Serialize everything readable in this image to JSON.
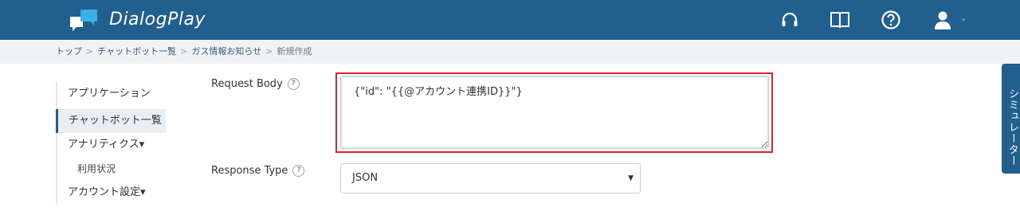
{
  "header": {
    "brand": "DialogPlay",
    "icons": [
      "headset-icon",
      "book-icon",
      "help-icon",
      "user-icon"
    ],
    "user_menu_caret": "⌄"
  },
  "breadcrumb": {
    "items": [
      "トップ",
      "チャットボット一覧",
      "ガス情報お知らせ"
    ],
    "current": "新規作成",
    "separator": ">"
  },
  "sidebar": {
    "items": [
      {
        "label": "アプリケーション"
      },
      {
        "label": "チャットボット一覧"
      },
      {
        "label": "アナリティクス▾"
      },
      {
        "label": "利用状況"
      },
      {
        "label": "アカウント設定▾"
      }
    ]
  },
  "form": {
    "request_body_label": "Request Body",
    "request_body_value": "{\"id\": \"{{@アカウント連携ID}}\"}",
    "response_type_label": "Response Type",
    "response_type_value": "JSON",
    "help_glyph": "?"
  },
  "simulator_tab": "シミュレーター",
  "colors": {
    "header_bg": "#215f8e",
    "highlight": "#e0242d",
    "breadcrumb_bg": "#eff3f6"
  }
}
